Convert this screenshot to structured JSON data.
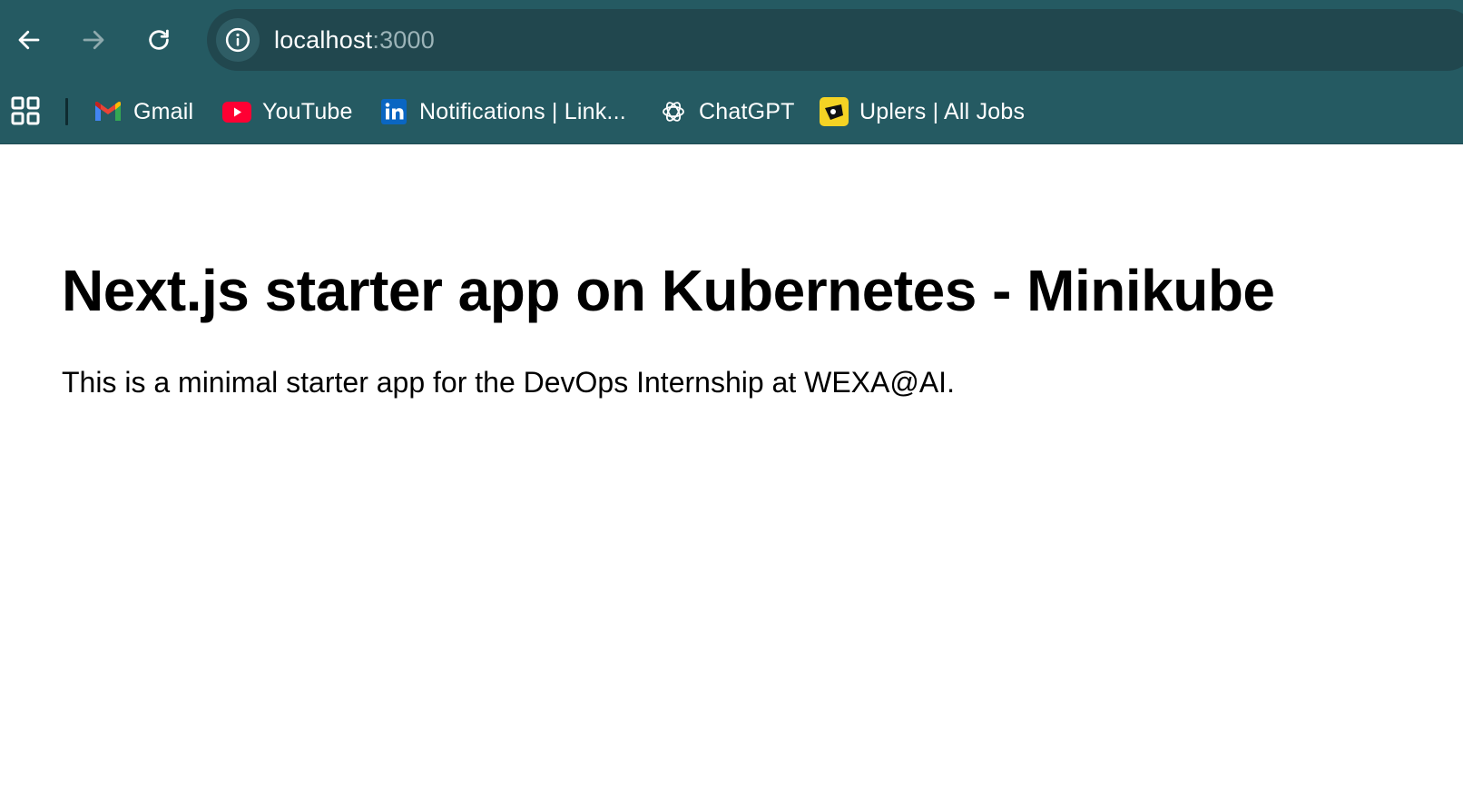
{
  "browser": {
    "url_host": "localhost",
    "url_port": ":3000",
    "colors": {
      "chrome_bg": "#255a62",
      "omnibox_bg": "#21474e",
      "url_port": "#9cb4b8"
    },
    "nav": {
      "back_icon": "arrow-left-icon",
      "forward_icon": "arrow-right-icon",
      "reload_icon": "reload-icon",
      "site_info_icon": "info-icon"
    }
  },
  "bookmarks": {
    "apps_icon": "apps-grid-icon",
    "items": [
      {
        "label": "Gmail",
        "icon": "gmail-icon"
      },
      {
        "label": "YouTube",
        "icon": "youtube-icon"
      },
      {
        "label": "Notifications | Link...",
        "icon": "linkedin-icon"
      },
      {
        "label": "ChatGPT",
        "icon": "chatgpt-icon"
      },
      {
        "label": "Uplers | All Jobs",
        "icon": "uplers-icon"
      }
    ]
  },
  "page": {
    "title": "Next.js starter app on Kubernetes - Minikube",
    "description": "This is a minimal starter app for the DevOps Internship at WEXA@AI."
  }
}
